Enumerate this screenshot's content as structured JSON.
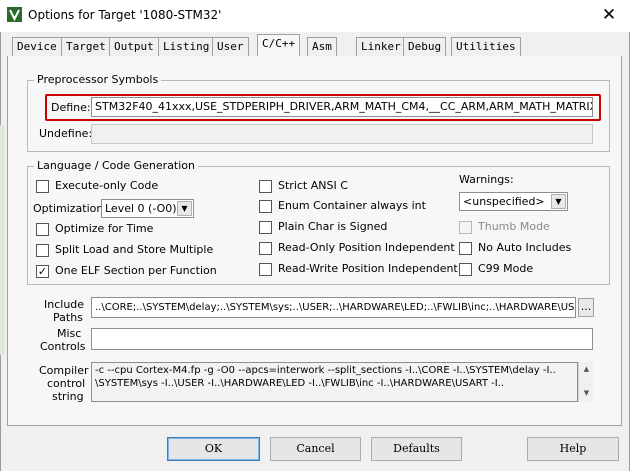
{
  "window": {
    "title": "Options for Target '1080-STM32'",
    "close_glyph": "✕",
    "app_icon": "keil-uvision-icon"
  },
  "tabs": [
    "Device",
    "Target",
    "Output",
    "Listing",
    "User",
    "C/C++",
    "Asm",
    "Linker",
    "Debug",
    "Utilities"
  ],
  "active_tab": "C/C++",
  "preprocessor": {
    "group_title": "Preprocessor Symbols",
    "define_label": "Define:",
    "define_value": "STM32F40_41xxx,USE_STDPERIPH_DRIVER,ARM_MATH_CM4,__CC_ARM,ARM_MATH_MATRIX_CHECK",
    "undefine_label": "Undefine:",
    "undefine_value": "",
    "highlight_color": "#cc0000"
  },
  "language": {
    "group_title": "Language / Code Generation",
    "execute_only": {
      "label": "Execute-only Code",
      "checked": false
    },
    "optimization_label": "Optimization:",
    "optimization_value": "Level 0 (-O0)",
    "optimize_time": {
      "label": "Optimize for Time",
      "checked": false
    },
    "split_load": {
      "label": "Split Load and Store Multiple",
      "checked": false
    },
    "one_elf": {
      "label": "One ELF Section per Function",
      "checked": true
    },
    "strict_ansi": {
      "label": "Strict ANSI C",
      "checked": false
    },
    "enum_int": {
      "label": "Enum Container always int",
      "checked": false
    },
    "plain_char": {
      "label": "Plain Char is Signed",
      "checked": false
    },
    "ropi": {
      "label": "Read-Only Position Independent",
      "checked": false
    },
    "rwpi": {
      "label": "Read-Write Position Independent",
      "checked": false
    },
    "warnings_label": "Warnings:",
    "warnings_value": "<unspecified>",
    "thumb_mode": {
      "label": "Thumb Mode",
      "checked": false
    },
    "no_auto_includes": {
      "label": "No Auto Includes",
      "checked": false
    },
    "c99_mode": {
      "label": "C99 Mode",
      "checked": false
    }
  },
  "include_paths": {
    "label_line1": "Include",
    "label_line2": "Paths",
    "value": "..\\CORE;..\\SYSTEM\\delay;..\\SYSTEM\\sys;..\\USER;..\\HARDWARE\\LED;..\\FWLIB\\inc;..\\HARDWARE\\USART",
    "browse_label": "..."
  },
  "misc_controls": {
    "label_line1": "Misc",
    "label_line2": "Controls",
    "value": ""
  },
  "compiler_control": {
    "label_line1": "Compiler",
    "label_line2": "control",
    "label_line3": "string",
    "line1": "-c --cpu Cortex-M4.fp -g -O0 --apcs=interwork --split_sections -I..\\CORE -I..\\SYSTEM\\delay -I..",
    "line2": "\\SYSTEM\\sys -I..\\USER -I..\\HARDWARE\\LED -I..\\FWLIB\\inc -I..\\HARDWARE\\USART -I.."
  },
  "buttons": {
    "ok": "OK",
    "cancel": "Cancel",
    "defaults": "Defaults",
    "help": "Help"
  }
}
